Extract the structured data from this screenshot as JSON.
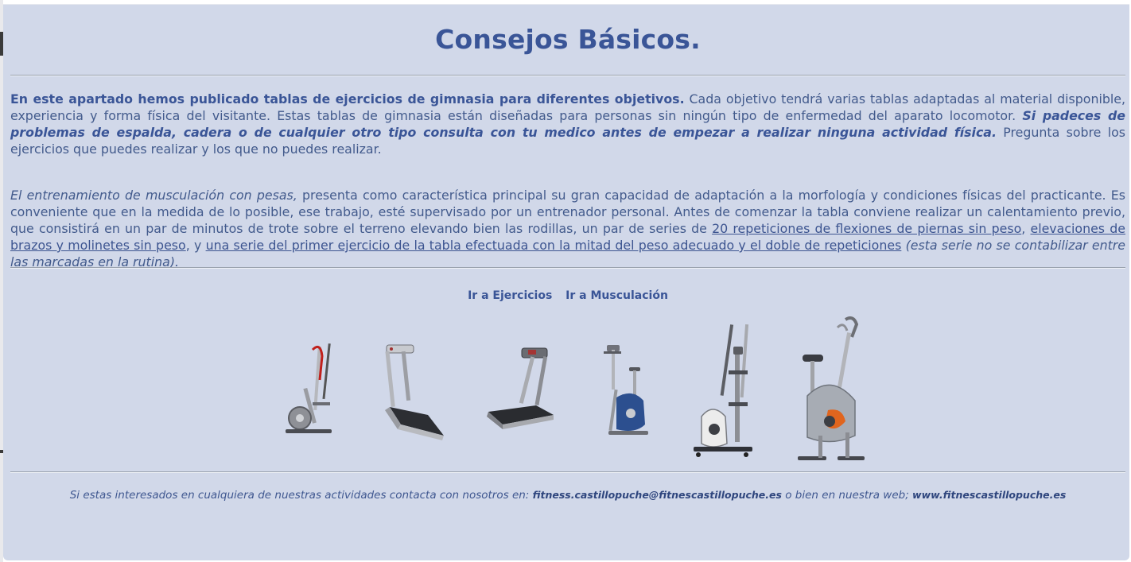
{
  "page": {
    "title": "Consejos Básicos."
  },
  "intro": {
    "bold_lead": "En este apartado hemos publicado tablas de ejercicios de gimnasia para diferentes objetivos.",
    "text1": " Cada objetivo tendrá varias tablas adaptadas al material disponible, experiencia y forma física del visitante. Estas tablas de gimnasia están diseñadas para personas sin ningún tipo de enfermedad del aparato locomotor. ",
    "warning": "Si padeces de problemas de espalda, cadera o de cualquier otro tipo consulta con tu medico antes de empezar a realizar ninguna actividad física.",
    "text2": " Pregunta sobre los ejercicios que puedes realizar y los que no puedes realizar."
  },
  "training": {
    "italic_lead": "El entrenamiento de musculación con pesas,",
    "text1": " presenta como característica principal su gran capacidad de adaptación a la morfología y condiciones físicas del practicante. Es conveniente que en la medida de lo posible, ese trabajo, esté supervisado por un entrenador personal. Antes de comenzar la tabla conviene realizar un calentamiento previo, que consistirá en un par de minutos de trote sobre el terreno elevando bien las rodillas, un par de series de ",
    "link1": "20 repeticiones de flexiones de piernas sin peso",
    "sep1": ", ",
    "link2": "elevaciones de brazos y molinetes sin peso",
    "sep2": ", y ",
    "link3": "una serie del primer ejercicio de la tabla efectuada con la mitad del peso adecuado y el doble de repeticiones",
    "italic_tail": " (esta serie no se contabilizar entre las marcadas en la rutina)."
  },
  "nav": {
    "link_ejercicios": "Ir a Ejercicios",
    "link_musculacion": "Ir a Musculación"
  },
  "machines": [
    {
      "name": "elliptical-1"
    },
    {
      "name": "treadmill-1"
    },
    {
      "name": "treadmill-2"
    },
    {
      "name": "exercise-bike-1"
    },
    {
      "name": "elliptical-2"
    },
    {
      "name": "exercise-bike-2"
    }
  ],
  "footer": {
    "text1": "Si estas interesados en cualquiera de nuestras actividades contacta con nosotros en: ",
    "email": "fitness.castillopuche@fitnescastillopuche.es",
    "text2": " o bien en nuestra web; ",
    "web": "www.fitnescastillopuche.es"
  },
  "colors": {
    "background": "#d1d8e9",
    "title": "#3a5597",
    "text": "#425a8c"
  }
}
